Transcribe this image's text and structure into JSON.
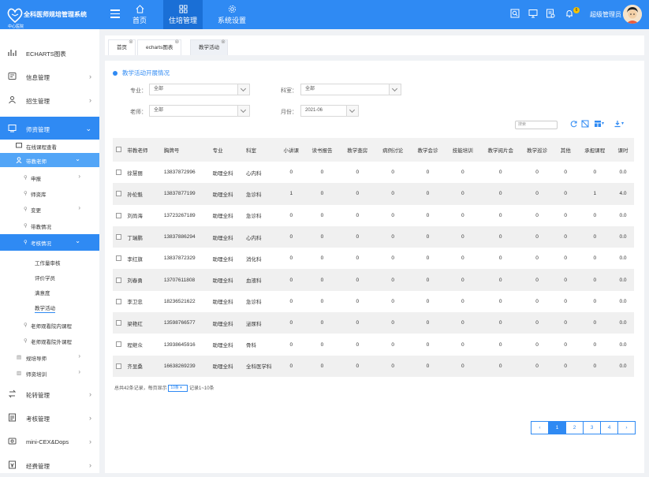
{
  "app": {
    "title": "全科医师规培管理系统",
    "subtitle": "中心医院",
    "logo": "heart-logo"
  },
  "topnav": [
    {
      "label": "首页",
      "icon": "home-icon"
    },
    {
      "label": "住培管理",
      "icon": "grid-icon"
    },
    {
      "label": "系统设置",
      "icon": "gear-icon"
    }
  ],
  "header": {
    "user": "超级管理员",
    "badge": "6"
  },
  "sidebar": {
    "items": [
      {
        "label": "ECHARTS图表",
        "icon": "chart-icon"
      },
      {
        "label": "信息管理",
        "icon": "info-icon"
      },
      {
        "label": "招生管理",
        "icon": "recruit-icon"
      },
      {
        "label": "师资管理",
        "icon": "teacher-icon"
      },
      {
        "label": "轮转管理",
        "icon": "rotation-icon"
      },
      {
        "label": "考核管理",
        "icon": "exam-icon"
      },
      {
        "label": "mini-CEX&Dops",
        "icon": "mini-icon"
      },
      {
        "label": "经费管理",
        "icon": "fund-icon"
      }
    ],
    "subitems": {
      "online": "在线课程查看",
      "mentor": "带教老师",
      "apply": "申报",
      "pool": "师资库",
      "change": "变更",
      "teach": "带教情况",
      "assess": "考核情况",
      "workload": "工作量审核",
      "evaluate": "评价学员",
      "satisfaction": "满意度",
      "activity": "教学活动",
      "in_course": "老师观看院内课程",
      "out_course": "老师观看院外课程",
      "tutor": "规培导师",
      "training": "师资培训"
    }
  },
  "tabs": [
    {
      "label": "首页"
    },
    {
      "label": "echarts图表"
    },
    {
      "label": "教学活动"
    }
  ],
  "panel": {
    "title": "教学活动开展情况"
  },
  "filters": {
    "major_label": "专业：",
    "major_value": "全部",
    "dept_label": "科室：",
    "dept_value": "全部",
    "teacher_label": "老师：",
    "teacher_value": "全部",
    "month_label": "月份：",
    "month_value": "2021-06"
  },
  "search": {
    "placeholder": "搜索"
  },
  "table": {
    "headers": [
      "带教老师",
      "胸牌号",
      "专业",
      "科室",
      "小讲课",
      "读书报告",
      "教学查房",
      "病例讨论",
      "教学会诊",
      "技能培训",
      "教学阅片会",
      "教学巡诊",
      "其他",
      "承担课程",
      "课时"
    ],
    "rows": [
      [
        "徐慧丽",
        "13837872996",
        "助理全科",
        "心内科",
        "0",
        "0",
        "0",
        "0",
        "0",
        "0",
        "0",
        "0",
        "0",
        "0",
        "0.0"
      ],
      [
        "孙伦魁",
        "13837877199",
        "助理全科",
        "急诊科",
        "1",
        "0",
        "0",
        "0",
        "0",
        "0",
        "0",
        "0",
        "0",
        "1",
        "4.0"
      ],
      [
        "刘尚海",
        "13723267189",
        "助理全科",
        "急诊科",
        "0",
        "0",
        "0",
        "0",
        "0",
        "0",
        "0",
        "0",
        "0",
        "0",
        "0.0"
      ],
      [
        "丁瑞鹏",
        "13837886294",
        "助理全科",
        "心内科",
        "0",
        "0",
        "0",
        "0",
        "0",
        "0",
        "0",
        "0",
        "0",
        "0",
        "0.0"
      ],
      [
        "李红旗",
        "13837872329",
        "助理全科",
        "消化科",
        "0",
        "0",
        "0",
        "0",
        "0",
        "0",
        "0",
        "0",
        "0",
        "0",
        "0.0"
      ],
      [
        "刘春勇",
        "13707611808",
        "助理全科",
        "血液科",
        "0",
        "0",
        "0",
        "0",
        "0",
        "0",
        "0",
        "0",
        "0",
        "0",
        "0.0"
      ],
      [
        "李卫忠",
        "18236521622",
        "助理全科",
        "急诊科",
        "0",
        "0",
        "0",
        "0",
        "0",
        "0",
        "0",
        "0",
        "0",
        "0",
        "0.0"
      ],
      [
        "梁艳红",
        "13598766577",
        "助理全科",
        "泌尿科",
        "0",
        "0",
        "0",
        "0",
        "0",
        "0",
        "0",
        "0",
        "0",
        "0",
        "0.0"
      ],
      [
        "程继众",
        "13938645916",
        "助理全科",
        "骨科",
        "0",
        "0",
        "0",
        "0",
        "0",
        "0",
        "0",
        "0",
        "0",
        "0",
        "0.0"
      ],
      [
        "齐显桑",
        "16638269239",
        "助理全科",
        "全科医学科",
        "0",
        "0",
        "0",
        "0",
        "0",
        "0",
        "0",
        "0",
        "0",
        "0",
        "0.0"
      ]
    ]
  },
  "footer": {
    "total": "总共42条记录，每页显示",
    "page_size": "10条",
    "range": "记录1~10条"
  },
  "pager": {
    "prev": "‹",
    "pages": [
      "1",
      "2",
      "3",
      "4"
    ],
    "next": "›"
  }
}
